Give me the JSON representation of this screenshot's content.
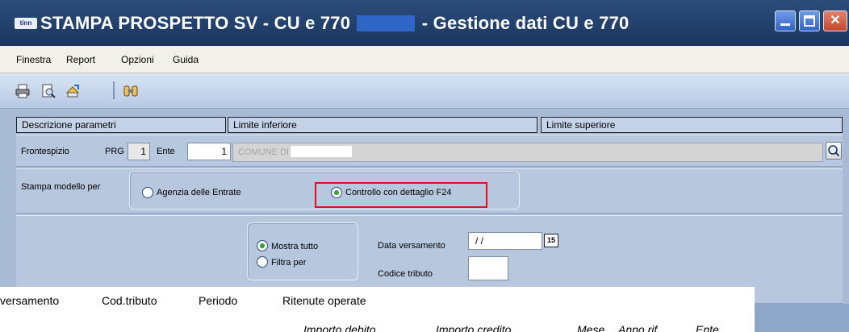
{
  "window": {
    "app_badge": "tinn",
    "title_prefix": "STAMPA PROSPETTO SV - CU e 770",
    "title_suffix": "- Gestione dati CU e 770",
    "colors": {
      "titlebar": "#22406c",
      "panel": "#b6c7de",
      "highlight": "#e01020"
    }
  },
  "menu": {
    "items": [
      "Finestra",
      "Report",
      "Opzioni",
      "Guida"
    ]
  },
  "toolbar": {
    "icons": [
      "printer-icon",
      "print-preview-icon",
      "export-icon",
      "binoculars-icon"
    ]
  },
  "grid": {
    "headers": [
      "Descrizione parametri",
      "Limite inferiore",
      "Limite superiore"
    ]
  },
  "frontespizio": {
    "label": "Frontespizio",
    "prg_label": "PRG",
    "prg_value": "1",
    "ente_label": "Ente",
    "ente_value": "1",
    "ente_name": "COMUNE DI"
  },
  "stampa": {
    "label": "Stampa modello per",
    "option1": "Agenzia delle Entrate",
    "option2": "Controllo con dettaglio F24",
    "selected": "Controllo con dettaglio F24"
  },
  "filter": {
    "option_all": "Mostra tutto",
    "option_filter": "Filtra per",
    "selected": "Mostra tutto",
    "data_label": "Data versamento",
    "data_value": "/ /",
    "calendar_badge": "15",
    "codice_label": "Codice tributo",
    "codice_value": ""
  },
  "bottom": {
    "columns": [
      "versamento",
      "Cod.tributo",
      "Periodo",
      "Ritenute operate"
    ],
    "subcolumns": [
      "Importo debito",
      "Importo credito",
      "Mese",
      "Anno rif.",
      "Ente"
    ]
  }
}
